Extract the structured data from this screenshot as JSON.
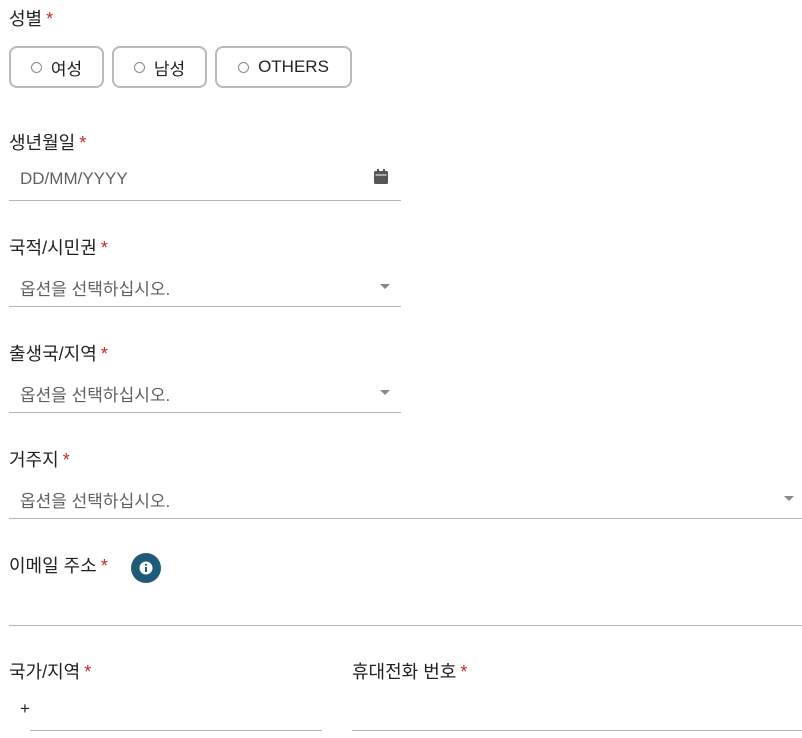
{
  "gender": {
    "label": "성별",
    "required_mark": "*",
    "options": [
      "여성",
      "남성",
      "OTHERS"
    ]
  },
  "birthdate": {
    "label": "생년월일",
    "required_mark": "*",
    "placeholder": "DD/MM/YYYY",
    "icon": "calendar-icon"
  },
  "nationality": {
    "label": "국적/시민권",
    "required_mark": "*",
    "placeholder": "옵션을 선택하십시오."
  },
  "birth_country": {
    "label": "출생국/지역",
    "required_mark": "*",
    "placeholder": "옵션을 선택하십시오."
  },
  "residence": {
    "label": "거주지",
    "required_mark": "*",
    "placeholder": "옵션을 선택하십시오."
  },
  "email": {
    "label": "이메일 주소",
    "required_mark": "*",
    "info_icon": "info-icon",
    "value": ""
  },
  "country_code": {
    "label": "국가/지역",
    "required_mark": "*",
    "prefix": "+"
  },
  "mobile": {
    "label": "휴대전화 번호",
    "required_mark": "*",
    "value": ""
  },
  "colors": {
    "required": "#c62828",
    "info_icon_bg": "#1f5a7a",
    "border": "#b9b9b9"
  }
}
